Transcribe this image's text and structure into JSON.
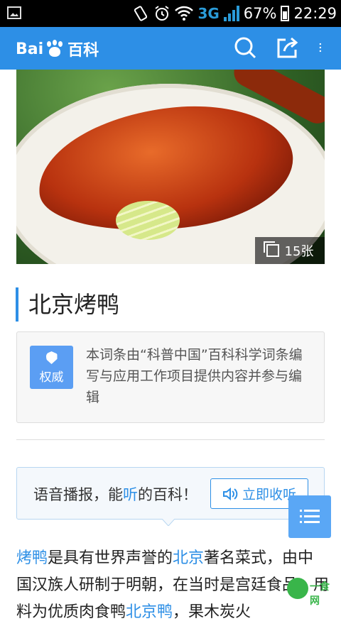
{
  "status_bar": {
    "network": "3G",
    "battery_percent": "67%",
    "time": "22:29",
    "icons": [
      "image-icon",
      "vibrate-icon",
      "alarm-icon",
      "wifi-icon",
      "signal-icon",
      "battery-icon"
    ]
  },
  "app_bar": {
    "logo_text_left": "Bai",
    "logo_text_right": "百科",
    "icons": [
      "search-icon",
      "share-icon",
      "more-icon"
    ]
  },
  "hero": {
    "photo_count": "15张"
  },
  "entry": {
    "title": "北京烤鸭"
  },
  "authority": {
    "badge_label": "权威",
    "description": "本词条由“科普中国”百科科学词条编写与应用工作项目提供内容并参与编辑"
  },
  "voice": {
    "label_prefix": "语音播报，能",
    "label_highlight": "听",
    "label_suffix": "的百科！",
    "button_label": "立即收听"
  },
  "body": {
    "segments": [
      {
        "text": "烤鸭",
        "link": true
      },
      {
        "text": "是具有世界声誉的",
        "link": false
      },
      {
        "text": "北京",
        "link": true
      },
      {
        "text": "著名菜式，由中国汉族人研制于明朝，在当时是宫廷食品，用料为优质肉食鸭",
        "link": false
      },
      {
        "text": "北京鸭",
        "link": true
      },
      {
        "text": "，果木炭火",
        "link": false
      }
    ]
  },
  "watermark": {
    "text": "一食网"
  },
  "colors": {
    "brand_blue": "#2d8fe6",
    "status_accent": "#2a9bd8"
  }
}
